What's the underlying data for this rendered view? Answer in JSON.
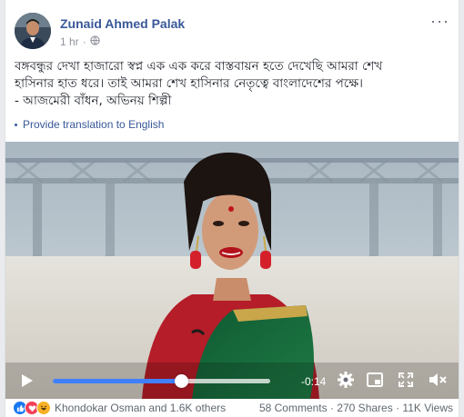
{
  "post": {
    "author": "Zunaid Ahmed Palak",
    "time": "1 hr",
    "privacy_icon": "globe-icon",
    "text_lines": [
      "বঙ্গবন্ধুর দেখা হাজারো স্বপ্ন এক এক করে বাস্তবায়ন হতে দেখেছি আমরা শেখ",
      "হাসিনার হাত ধরে। তাই আমরা শেখ হাসিনার নেতৃত্বে বাংলাদেশের পক্ষে।",
      "- আজমেরী বাঁধন, অভিনয় শিল্পী"
    ],
    "translate_label": "Provide translation to English"
  },
  "video": {
    "time_remaining": "-0:14",
    "progress": 0.59
  },
  "footer": {
    "reactions_label": "Khondokar Osman and 1.6K others",
    "comments": "58 Comments",
    "shares": "270 Shares",
    "views": "11K Views"
  },
  "colors": {
    "link": "#385898",
    "progress": "#4080ff",
    "like": "#1877f2",
    "love": "#f33e58",
    "haha": "#f7b125"
  }
}
